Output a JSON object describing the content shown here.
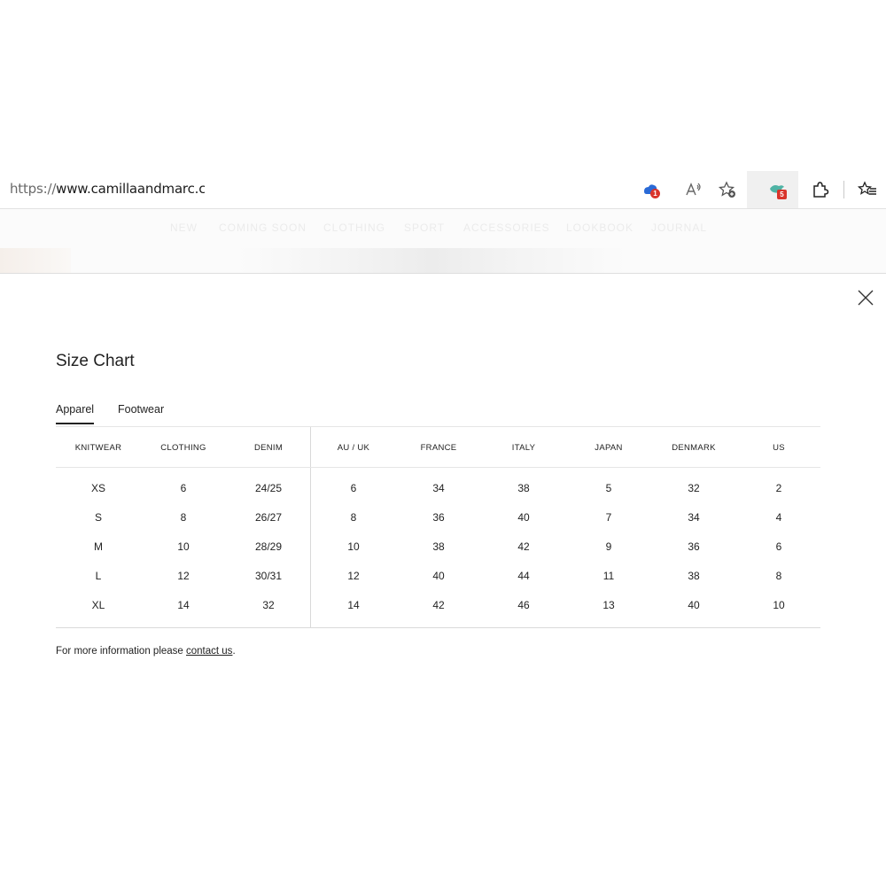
{
  "browser": {
    "url_scheme": "https://",
    "url_host": "www.camillaandmarc.com",
    "ext_badge_1": "1",
    "ext_badge_2": "5",
    "icons": [
      "cloud-shield-icon",
      "read-aloud-icon",
      "add-favorite-icon",
      "extension-bird-icon",
      "extensions-puzzle-icon",
      "favorites-icon"
    ]
  },
  "site_nav": {
    "items": [
      "NEW",
      "COMING SOON",
      "CLOTHING",
      "SPORT",
      "ACCESSORIES",
      "LOOKBOOK",
      "JOURNAL"
    ]
  },
  "modal": {
    "title": "Size Chart",
    "tabs": [
      {
        "label": "Apparel",
        "active": true
      },
      {
        "label": "Footwear",
        "active": false
      }
    ],
    "size_table": {
      "columns": [
        "KNITWEAR",
        "CLOTHING",
        "DENIM",
        "AU / UK",
        "FRANCE",
        "ITALY",
        "JAPAN",
        "DENMARK",
        "US"
      ],
      "rows": [
        [
          "XS",
          "6",
          "24/25",
          "6",
          "34",
          "38",
          "5",
          "32",
          "2"
        ],
        [
          "S",
          "8",
          "26/27",
          "8",
          "36",
          "40",
          "7",
          "34",
          "4"
        ],
        [
          "M",
          "10",
          "28/29",
          "10",
          "38",
          "42",
          "9",
          "36",
          "6"
        ],
        [
          "L",
          "12",
          "30/31",
          "12",
          "40",
          "44",
          "11",
          "38",
          "8"
        ],
        [
          "XL",
          "14",
          "32",
          "14",
          "42",
          "46",
          "13",
          "40",
          "10"
        ]
      ]
    },
    "footnote_prefix": "For more information please ",
    "footnote_link": "contact us",
    "footnote_suffix": "."
  },
  "colors": {
    "accent_text": "#222222",
    "badge_red": "#d9342b",
    "bird_teal": "#4fb3a5"
  }
}
